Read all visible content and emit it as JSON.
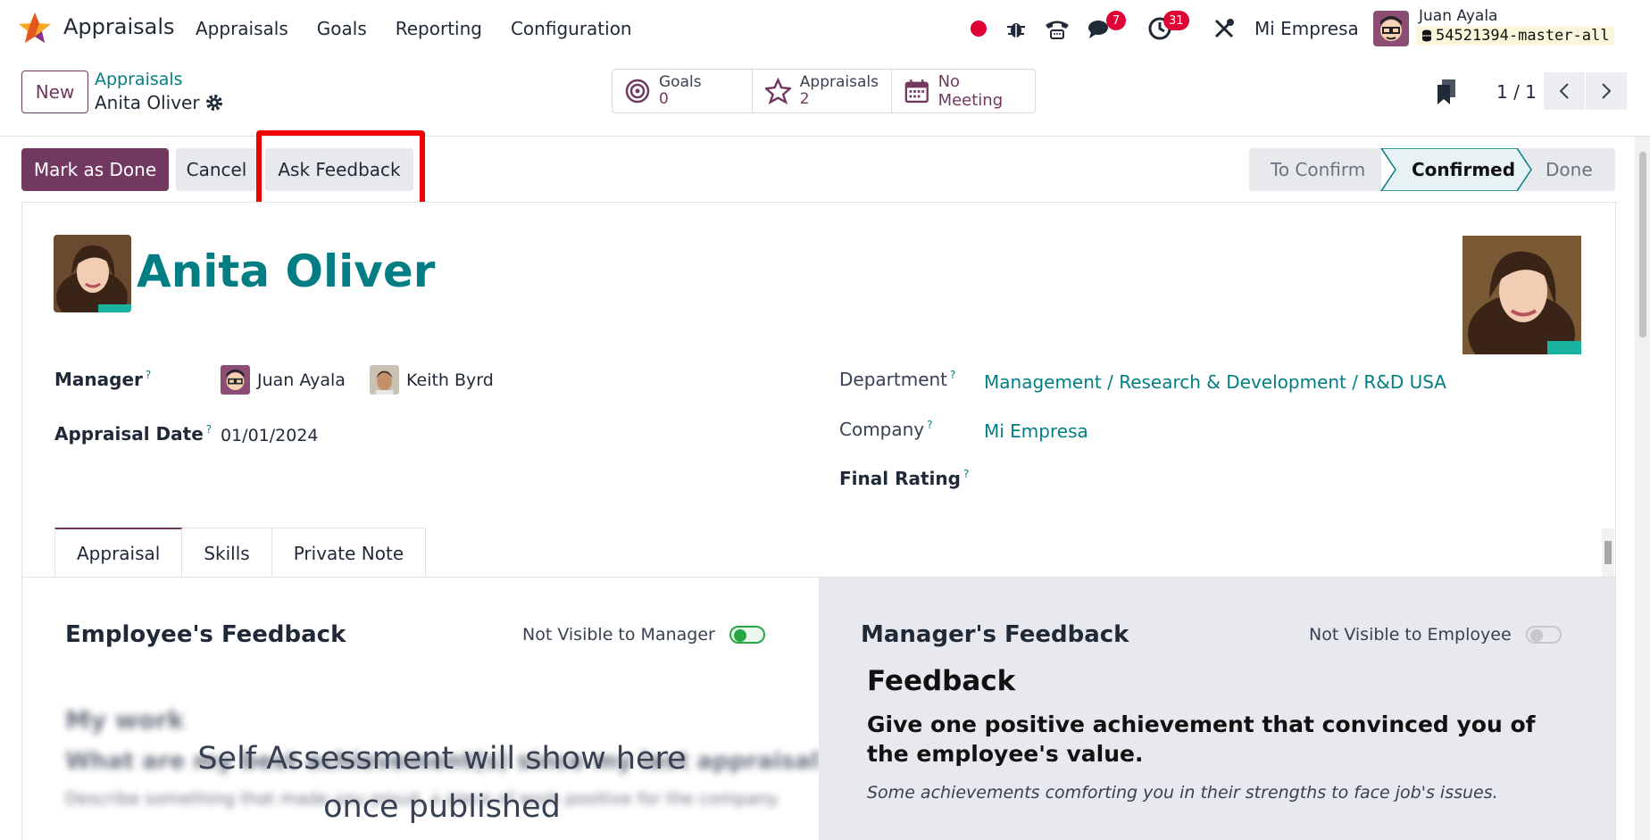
{
  "navbar": {
    "app_name": "Appraisals",
    "menu": [
      "Appraisals",
      "Goals",
      "Reporting",
      "Configuration"
    ],
    "messages_count": "7",
    "activities_count": "31",
    "company": "Mi Empresa",
    "user_name": "Juan Ayala",
    "database": "54521394-master-all"
  },
  "control": {
    "new_label": "New",
    "breadcrumb_parent": "Appraisals",
    "breadcrumb_current": "Anita Oliver",
    "smart_buttons": [
      {
        "label": "Goals",
        "value": "0",
        "icon": "target-icon"
      },
      {
        "label": "Appraisals",
        "value": "2",
        "icon": "star-icon"
      },
      {
        "label": "No Meeting",
        "icon": "calendar-icon"
      }
    ],
    "pager": "1 / 1"
  },
  "status": {
    "mark_done": "Mark as Done",
    "cancel": "Cancel",
    "ask_feedback": "Ask Feedback",
    "stages": [
      "To Confirm",
      "Confirmed",
      "Done"
    ],
    "active_stage": "Confirmed"
  },
  "form": {
    "employee_name": "Anita Oliver",
    "manager_label": "Manager",
    "managers": [
      "Juan Ayala",
      "Keith Byrd"
    ],
    "appraisal_date_label": "Appraisal Date",
    "appraisal_date": "01/01/2024",
    "department_label": "Department",
    "department": "Management / Research & Development / R&D USA",
    "company_label": "Company",
    "company": "Mi Empresa",
    "final_rating_label": "Final Rating",
    "help_mark": "?"
  },
  "tabs": [
    "Appraisal",
    "Skills",
    "Private Note"
  ],
  "employee_feedback": {
    "title": "Employee's Feedback",
    "toggle_label": "Not Visible to Manager",
    "blurred_heading": "My work",
    "blurred_question": "What are my best achievement(s) since my last appraisal?",
    "blurred_hint": "Describe something that made you proud, a piece of work positive for the company.",
    "placeholder_line1": "Self Assessment will show here",
    "placeholder_line2": "once published"
  },
  "manager_feedback": {
    "title": "Manager's Feedback",
    "toggle_label": "Not Visible to Employee",
    "heading": "Feedback",
    "question": "Give one positive achievement that convinced you of the employee's value.",
    "note": "Some achievements comforting you in their strengths to face job's issues."
  },
  "colors": {
    "brand": "#71395f",
    "link": "#017e84",
    "highlight": "#f10000",
    "badge": "#e00034"
  }
}
